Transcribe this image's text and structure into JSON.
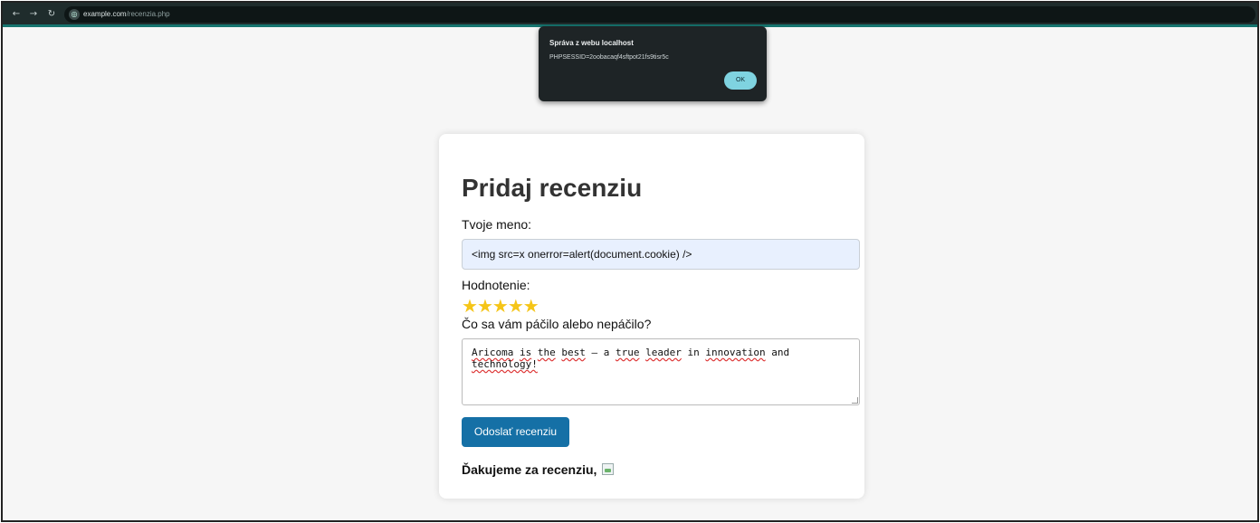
{
  "browser": {
    "back_icon": "arrow-left",
    "forward_icon": "arrow-right",
    "reload_icon": "reload",
    "url_host": "example.com",
    "url_path": "/recenzia.php"
  },
  "alert": {
    "title": "Správa z webu localhost",
    "message": "PHPSESSID=2oobacaqf4sftpot21fs9tisr5c",
    "ok_label": "OK"
  },
  "form": {
    "title": "Pridaj recenziu",
    "name_label": "Tvoje meno:",
    "name_value": "<img src=x onerror=alert(document.cookie) />",
    "rating_label": "Hodnotenie:",
    "rating_value": 5,
    "rating_max": 5,
    "comment_label": "Čo sa vám páčilo alebo nepáčilo?",
    "comment_words": [
      "Aricoma",
      "is",
      "the",
      "best",
      "–",
      "a",
      "true",
      "leader",
      "in",
      "innovation",
      "and",
      "technology!"
    ],
    "submit_label": "Odoslať recenziu",
    "thanks_text": "Ďakujeme za recenziu,"
  },
  "colors": {
    "star": "#f5c518",
    "submit_button": "#1570a6",
    "input_autofill": "#e8f0fe",
    "alert_ok": "#7fd3e0"
  }
}
